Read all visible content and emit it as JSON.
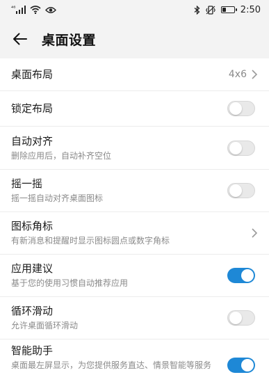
{
  "status_bar": {
    "signal_label": "⁴⁶",
    "time": "2:50",
    "battery_level": 0.35,
    "icons": [
      "signal-icon",
      "wifi-icon",
      "eye-icon",
      "bluetooth-icon",
      "vibrate-icon",
      "battery-icon"
    ]
  },
  "header": {
    "title": "桌面设置",
    "back_icon": "arrow-left-icon"
  },
  "settings": [
    {
      "title": "桌面布局",
      "value": "4x6",
      "control": "chevron"
    },
    {
      "title": "锁定布局",
      "control": "switch",
      "on": false
    },
    {
      "title": "自动对齐",
      "subtitle": "删除应用后，自动补齐空位",
      "control": "switch",
      "on": false
    },
    {
      "title": "摇一摇",
      "subtitle": "摇一摇自动对齐桌面图标",
      "control": "switch",
      "on": false
    },
    {
      "title": "图标角标",
      "subtitle": "有新消息和提醒时显示图标圆点或数字角标",
      "control": "chevron"
    },
    {
      "title": "应用建议",
      "subtitle": "基于您的使用习惯自动推荐应用",
      "control": "switch",
      "on": true
    },
    {
      "title": "循环滑动",
      "subtitle": "允许桌面循环滑动",
      "control": "switch",
      "on": false
    },
    {
      "title": "智能助手",
      "subtitle": "桌面最左屏显示，为您提供服务直达、情景智能等服务",
      "control": "switch",
      "on": true
    }
  ],
  "colors": {
    "accent": "#1e88d6",
    "background": "#f3f3f3",
    "card": "#ffffff",
    "subtitle": "#8a8a8a"
  }
}
